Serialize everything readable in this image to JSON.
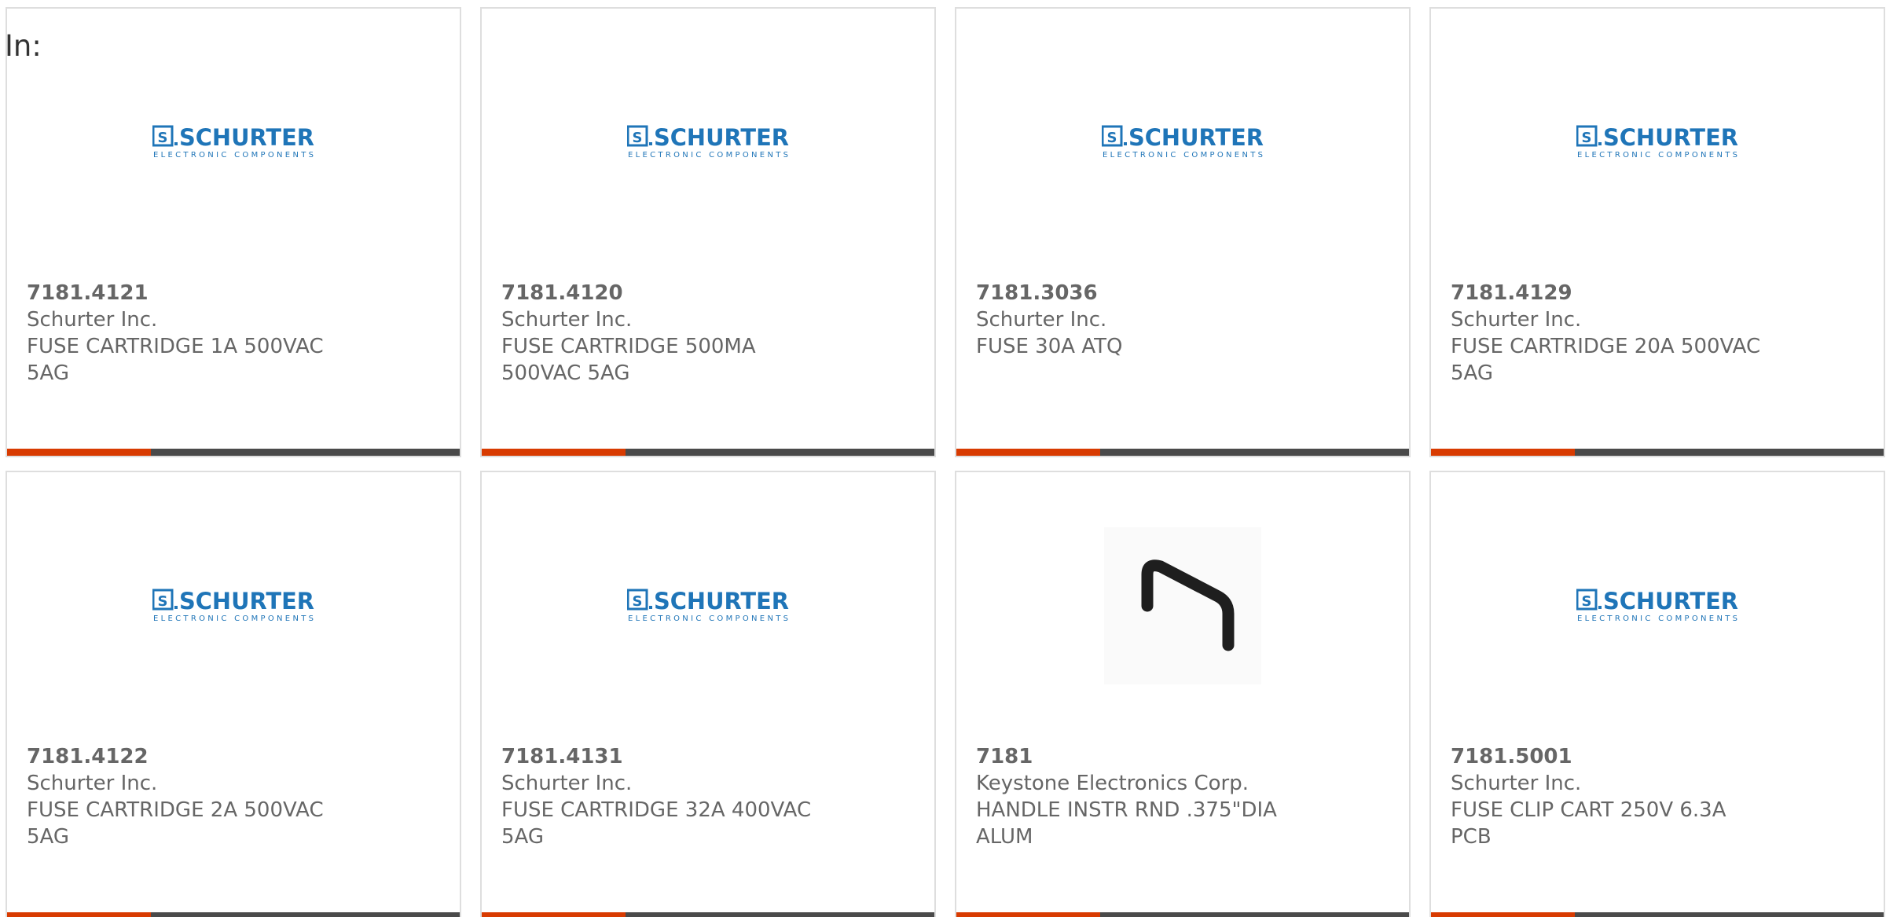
{
  "header": {
    "in_label": "In:"
  },
  "colors": {
    "bar_accent": "#d83b01",
    "bar_rest": "#4a4a4a",
    "logo_blue": "#1f75b8"
  },
  "logo": {
    "brand": "SCHURTER",
    "tagline": "ELECTRONIC COMPONENTS",
    "mark": "S"
  },
  "products": [
    {
      "part_number": "7181.4121",
      "manufacturer": "Schurter Inc.",
      "description": "FUSE CARTRIDGE 1A 500VAC 5AG",
      "image": "schurter-logo"
    },
    {
      "part_number": "7181.4120",
      "manufacturer": "Schurter Inc.",
      "description": "FUSE CARTRIDGE 500MA 500VAC 5AG",
      "image": "schurter-logo"
    },
    {
      "part_number": "7181.3036",
      "manufacturer": "Schurter Inc.",
      "description": "FUSE 30A ATQ",
      "image": "schurter-logo"
    },
    {
      "part_number": "7181.4129",
      "manufacturer": "Schurter Inc.",
      "description": "FUSE CARTRIDGE 20A 500VAC 5AG",
      "image": "schurter-logo"
    },
    {
      "part_number": "7181.4122",
      "manufacturer": "Schurter Inc.",
      "description": "FUSE CARTRIDGE 2A 500VAC 5AG",
      "image": "schurter-logo"
    },
    {
      "part_number": "7181.4131",
      "manufacturer": "Schurter Inc.",
      "description": "FUSE CARTRIDGE 32A 400VAC 5AG",
      "image": "schurter-logo"
    },
    {
      "part_number": "7181",
      "manufacturer": "Keystone Electronics Corp.",
      "description": "HANDLE INSTR RND .375\"DIA ALUM",
      "image": "handle-photo"
    },
    {
      "part_number": "7181.5001",
      "manufacturer": "Schurter Inc.",
      "description": "FUSE CLIP CART 250V 6.3A PCB",
      "image": "schurter-logo"
    }
  ]
}
